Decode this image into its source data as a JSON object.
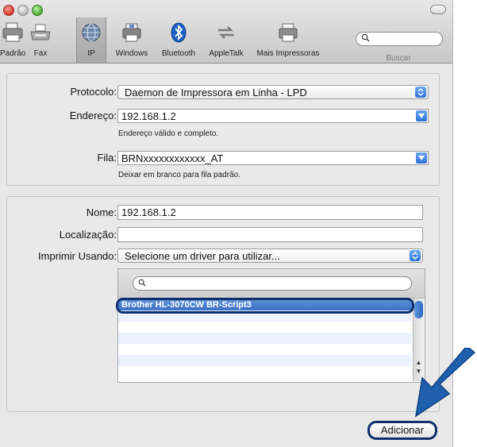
{
  "toolbar": {
    "items": [
      {
        "label": "Padrão",
        "icon": "default-printer-icon"
      },
      {
        "label": "Fax",
        "icon": "fax-icon"
      },
      {
        "label": "IP",
        "icon": "ip-globe-icon"
      },
      {
        "label": "Windows",
        "icon": "windows-printer-icon"
      },
      {
        "label": "Bluetooth",
        "icon": "bluetooth-icon"
      },
      {
        "label": "AppleTalk",
        "icon": "appletalk-icon"
      },
      {
        "label": "Mais Impressoras",
        "icon": "more-printers-icon"
      }
    ],
    "search": {
      "caption": "Buscar",
      "value": ""
    }
  },
  "connection": {
    "protocol_label": "Protocolo:",
    "protocol_value": "Daemon de Impressora em Linha - LPD",
    "address_label": "Endereço:",
    "address_value": "192.168.1.2",
    "address_hint": "Endereço válido e completo.",
    "queue_label": "Fila:",
    "queue_value": "BRNxxxxxxxxxxxx_AT",
    "queue_hint": "Deixar em branco para fila padrão."
  },
  "printer": {
    "name_label": "Nome:",
    "name_value": "192.168.1.2",
    "location_label": "Localização:",
    "location_value": "",
    "driver_label": "Imprimir Usando:",
    "driver_value": "Selecione um driver para utilizar...",
    "driver_search_value": "",
    "driver_list": [
      "Brother HL-3070CW BR-Script3"
    ]
  },
  "actions": {
    "add_label": "Adicionar"
  },
  "colors": {
    "selection": "#3c6fc2",
    "callout": "#1f5fae",
    "outline": "#0d2f6c"
  }
}
